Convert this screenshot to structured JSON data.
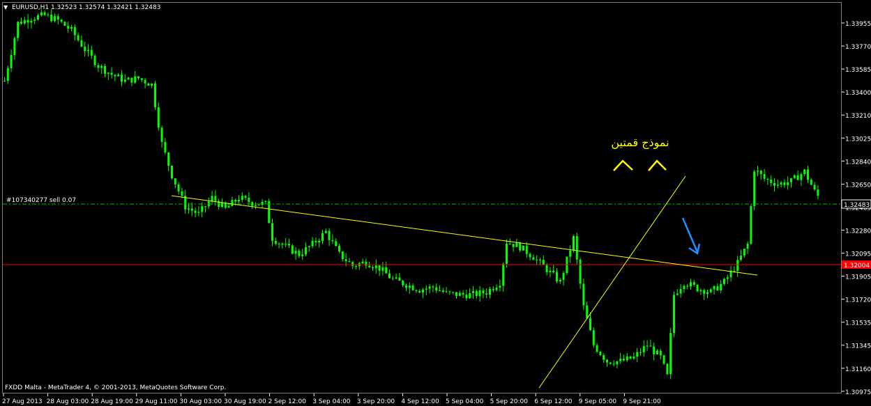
{
  "header": {
    "menu_glyph": "▼",
    "symbol_line": "EURUSD,H1  1.32523 1.32574 1.32421 1.32483"
  },
  "order_label": "#107340277 sell 0.07",
  "annotation_text": "نموذج قمتين",
  "footer_text": "FXDD Malta - MetaTrader 4, © 2001-2013, MetaQuotes Software Corp.",
  "price_axis": {
    "ticks": [
      "1.33955",
      "1.33770",
      "1.33585",
      "1.33400",
      "1.33210",
      "1.33025",
      "1.32840",
      "1.32650",
      "1.32465",
      "1.32280",
      "1.32095",
      "1.31905",
      "1.31720",
      "1.31535",
      "1.31345",
      "1.31160",
      "1.30975"
    ],
    "current_price_badge": "1.32483",
    "level_badge": "1.32004"
  },
  "time_axis": {
    "labels": [
      "27 Aug 2013",
      "28 Aug 03:00",
      "28 Aug 19:00",
      "29 Aug 11:00",
      "30 Aug 03:00",
      "30 Aug 19:00",
      "2 Sep 12:00",
      "3 Sep 04:00",
      "3 Sep 20:00",
      "4 Sep 12:00",
      "5 Sep 04:00",
      "5 Sep 20:00",
      "6 Sep 12:00",
      "9 Sep 05:00",
      "9 Sep 21:00"
    ]
  },
  "colors": {
    "background": "#000000",
    "candles": "#00ff00",
    "trendline": "#ffff00",
    "support_line": "#ff0000",
    "order_line": "#00c000",
    "arrow": "#1e90ff",
    "annotation": "#ffff00",
    "text": "#ffffff"
  },
  "chart_data": {
    "type": "candlestick",
    "symbol": "EURUSD",
    "timeframe": "H1",
    "ohlc_last": {
      "open": 1.32523,
      "high": 1.32574,
      "low": 1.32421,
      "close": 1.32483
    },
    "ylim": [
      1.3092,
      1.3402
    ],
    "x_ticks": [
      "27 Aug 2013",
      "28 Aug 03:00",
      "28 Aug 19:00",
      "29 Aug 11:00",
      "30 Aug 03:00",
      "30 Aug 19:00",
      "2 Sep 12:00",
      "3 Sep 04:00",
      "3 Sep 20:00",
      "4 Sep 12:00",
      "5 Sep 04:00",
      "5 Sep 20:00",
      "6 Sep 12:00",
      "9 Sep 05:00",
      "9 Sep 21:00"
    ],
    "close_path": [
      [
        0,
        1.334
      ],
      [
        4,
        1.3386
      ],
      [
        8,
        1.339
      ],
      [
        12,
        1.3392
      ],
      [
        16,
        1.3388
      ],
      [
        20,
        1.338
      ],
      [
        24,
        1.3365
      ],
      [
        28,
        1.3352
      ],
      [
        32,
        1.3345
      ],
      [
        36,
        1.334
      ],
      [
        40,
        1.3342
      ],
      [
        44,
        1.3337
      ],
      [
        47,
        1.329
      ],
      [
        50,
        1.3265
      ],
      [
        54,
        1.324
      ],
      [
        58,
        1.3234
      ],
      [
        62,
        1.3247
      ],
      [
        66,
        1.3238
      ],
      [
        70,
        1.3247
      ],
      [
        74,
        1.3243
      ],
      [
        78,
        1.3242
      ],
      [
        80,
        1.3215
      ],
      [
        84,
        1.3208
      ],
      [
        88,
        1.3202
      ],
      [
        92,
        1.321
      ],
      [
        96,
        1.322
      ],
      [
        100,
        1.3202
      ],
      [
        104,
        1.3193
      ],
      [
        108,
        1.3196
      ],
      [
        112,
        1.3191
      ],
      [
        116,
        1.3182
      ],
      [
        120,
        1.3178
      ],
      [
        124,
        1.3174
      ],
      [
        128,
        1.3176
      ],
      [
        132,
        1.3171
      ],
      [
        136,
        1.317
      ],
      [
        140,
        1.317
      ],
      [
        144,
        1.3172
      ],
      [
        148,
        1.318
      ],
      [
        150,
        1.3212
      ],
      [
        154,
        1.3208
      ],
      [
        158,
        1.32
      ],
      [
        162,
        1.319
      ],
      [
        166,
        1.318
      ],
      [
        170,
        1.3215
      ],
      [
        173,
        1.316
      ],
      [
        176,
        1.313
      ],
      [
        180,
        1.3117
      ],
      [
        184,
        1.3117
      ],
      [
        188,
        1.312
      ],
      [
        192,
        1.313
      ],
      [
        196,
        1.312
      ],
      [
        198,
        1.3105
      ],
      [
        200,
        1.317
      ],
      [
        203,
        1.318
      ],
      [
        207,
        1.3175
      ],
      [
        211,
        1.3172
      ],
      [
        215,
        1.318
      ],
      [
        219,
        1.3195
      ],
      [
        222,
        1.321
      ],
      [
        224,
        1.327
      ],
      [
        227,
        1.3262
      ],
      [
        231,
        1.3258
      ],
      [
        235,
        1.326
      ],
      [
        239,
        1.3268
      ],
      [
        242,
        1.3252
      ],
      [
        243,
        1.32483
      ]
    ],
    "horizontal_lines": [
      {
        "label": "#107340277 sell 0.07",
        "price": 1.32483
      },
      {
        "price": 1.32004
      }
    ],
    "trendlines": [
      {
        "from": [
          62,
          1.3254
        ],
        "to": [
          276,
          1.3192
        ]
      },
      {
        "from": [
          194,
          1.3098
        ],
        "to": [
          246,
          1.3271
        ]
      }
    ],
    "annotations": [
      {
        "text": "نموذج قمتين",
        "type": "double-top"
      }
    ]
  }
}
